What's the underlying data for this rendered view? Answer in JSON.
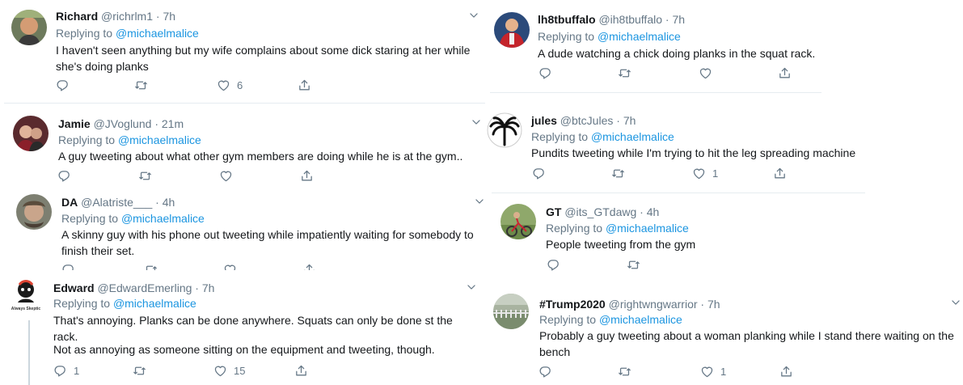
{
  "replying_label": "Replying to",
  "tweets": [
    {
      "name": "Richard",
      "handle": "@richrlm1",
      "dot": "·",
      "time": "7h",
      "mention": "@michaelmalice",
      "text": "I haven't seen anything but my wife complains about some dick staring at her while she's doing planks",
      "likes": "6"
    },
    {
      "name": "lh8tbuffalo",
      "handle": "@ih8tbuffalo",
      "dot": "·",
      "time": "7h",
      "mention": "@michaelmalice",
      "text": "A dude watching a chick doing planks in the squat rack."
    },
    {
      "name": "Jamie",
      "handle": "@JVoglund",
      "dot": "·",
      "time": "21m",
      "mention": "@michaelmalice",
      "text": "A guy tweeting about what other gym members are doing while he is at the gym.."
    },
    {
      "name": "jules",
      "handle": "@btcJules",
      "dot": "·",
      "time": "7h",
      "mention": "@michaelmalice",
      "text": "Pundits tweeting while I'm trying to hit the leg spreading machine",
      "likes": "1"
    },
    {
      "name": "DA",
      "handle": "@Alatriste___",
      "dot": "·",
      "time": "4h",
      "mention": "@michaelmalice",
      "text": "A skinny guy with his phone out tweeting while impatiently waiting for somebody to finish their set."
    },
    {
      "name": "GT",
      "handle": "@its_GTdawg",
      "dot": "·",
      "time": "4h",
      "mention": "@michaelmalice",
      "text": "People tweeting from the gym"
    },
    {
      "name": "Edward",
      "handle": "@EdwardEmerling",
      "dot": "·",
      "time": "7h",
      "mention": "@michaelmalice",
      "text": "That's annoying. Planks can be done anywhere. Squats can only be done st the rack.",
      "text2": "Not as annoying as someone sitting on the equipment and tweeting, though.",
      "replies": "1",
      "likes": "15",
      "avatar_caption": "Always Skeptic"
    },
    {
      "name": "#Trump2020",
      "handle": "@rightwngwarrior",
      "dot": "·",
      "time": "7h",
      "mention": "@michaelmalice",
      "text": "Probably a guy tweeting about a woman planking while I stand there waiting on the bench",
      "likes": "1"
    }
  ],
  "colors": {
    "link": "#1b95e0",
    "muted": "#657786",
    "text": "#14171a",
    "divider": "#e6ecf0"
  }
}
